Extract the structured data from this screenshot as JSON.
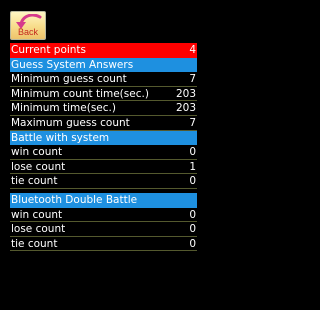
{
  "back_button": {
    "label": "Back",
    "icon": "return-arrow-icon"
  },
  "current_points": {
    "label": "Current points",
    "value": "4",
    "highlight_color": "#ff0000"
  },
  "sections": [
    {
      "title": "Guess System Answers",
      "header_color": "#1e90e0",
      "rows": [
        {
          "label": "Minimum guess count",
          "value": "7"
        },
        {
          "label": "Minimum count time(sec.)",
          "value": "203"
        },
        {
          "label": "Minimum time(sec.)",
          "value": "203"
        },
        {
          "label": "Maximum guess count",
          "value": "7"
        }
      ]
    },
    {
      "title": "Battle with system",
      "header_color": "#1e90e0",
      "rows": [
        {
          "label": "win count",
          "value": "0"
        },
        {
          "label": "lose count",
          "value": "1"
        },
        {
          "label": "tie count",
          "value": "0"
        }
      ]
    },
    {
      "title": "Bluetooth Double Battle",
      "header_color": "#1e90e0",
      "rows": [
        {
          "label": "win count",
          "value": "0"
        },
        {
          "label": "lose count",
          "value": "0"
        },
        {
          "label": "tie count",
          "value": "0"
        }
      ]
    }
  ]
}
